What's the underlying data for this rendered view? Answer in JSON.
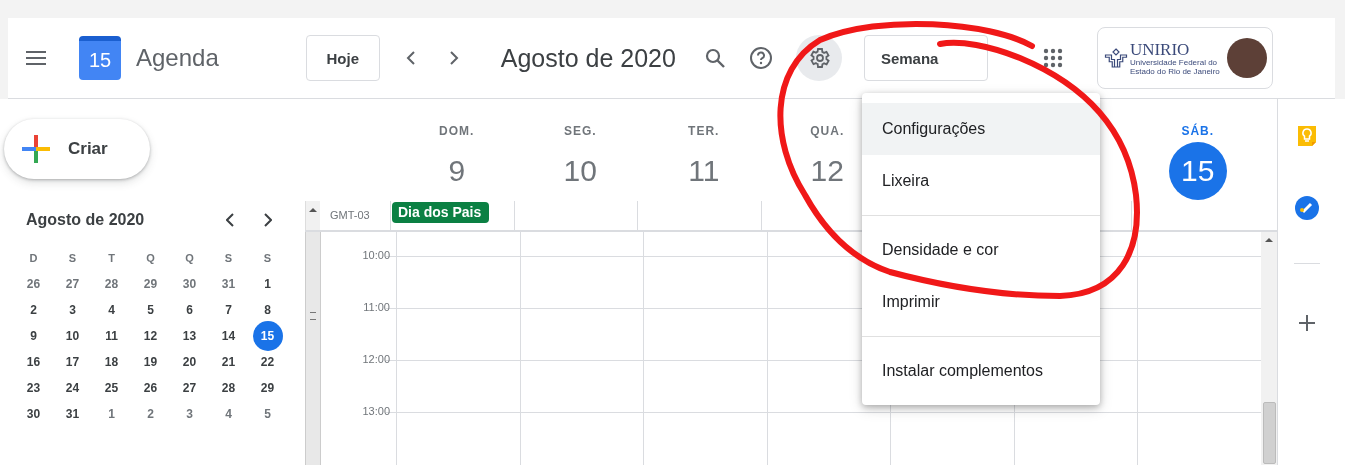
{
  "header": {
    "app_name": "Agenda",
    "logo_day": "15",
    "today_button": "Hoje",
    "period_title": "Agosto de 2020",
    "view_button": "Semana",
    "settings_pressed": true,
    "account": {
      "org_name": "UNIRIO",
      "org_subtitle_lines": [
        "Universidade Federal do",
        "Estado do Rio de Janeiro"
      ]
    }
  },
  "create_button": "Criar",
  "mini_calendar": {
    "title": "Agosto de 2020",
    "weekdays": [
      "D",
      "S",
      "T",
      "Q",
      "Q",
      "S",
      "S"
    ],
    "weeks": [
      [
        {
          "text": "26",
          "other_month": true,
          "selected": false
        },
        {
          "text": "27",
          "other_month": true,
          "selected": false
        },
        {
          "text": "28",
          "other_month": true,
          "selected": false
        },
        {
          "text": "29",
          "other_month": true,
          "selected": false
        },
        {
          "text": "30",
          "other_month": true,
          "selected": false
        },
        {
          "text": "31",
          "other_month": true,
          "selected": false
        },
        {
          "text": "1",
          "other_month": false,
          "selected": false
        }
      ],
      [
        {
          "text": "2",
          "other_month": false,
          "selected": false
        },
        {
          "text": "3",
          "other_month": false,
          "selected": false
        },
        {
          "text": "4",
          "other_month": false,
          "selected": false
        },
        {
          "text": "5",
          "other_month": false,
          "selected": false
        },
        {
          "text": "6",
          "other_month": false,
          "selected": false
        },
        {
          "text": "7",
          "other_month": false,
          "selected": false
        },
        {
          "text": "8",
          "other_month": false,
          "selected": false
        }
      ],
      [
        {
          "text": "9",
          "other_month": false,
          "selected": false
        },
        {
          "text": "10",
          "other_month": false,
          "selected": false
        },
        {
          "text": "11",
          "other_month": false,
          "selected": false
        },
        {
          "text": "12",
          "other_month": false,
          "selected": false
        },
        {
          "text": "13",
          "other_month": false,
          "selected": false
        },
        {
          "text": "14",
          "other_month": false,
          "selected": false
        },
        {
          "text": "15",
          "other_month": false,
          "selected": true
        }
      ],
      [
        {
          "text": "16",
          "other_month": false,
          "selected": false
        },
        {
          "text": "17",
          "other_month": false,
          "selected": false
        },
        {
          "text": "18",
          "other_month": false,
          "selected": false
        },
        {
          "text": "19",
          "other_month": false,
          "selected": false
        },
        {
          "text": "20",
          "other_month": false,
          "selected": false
        },
        {
          "text": "21",
          "other_month": false,
          "selected": false
        },
        {
          "text": "22",
          "other_month": false,
          "selected": false
        }
      ],
      [
        {
          "text": "23",
          "other_month": false,
          "selected": false
        },
        {
          "text": "24",
          "other_month": false,
          "selected": false
        },
        {
          "text": "25",
          "other_month": false,
          "selected": false
        },
        {
          "text": "26",
          "other_month": false,
          "selected": false
        },
        {
          "text": "27",
          "other_month": false,
          "selected": false
        },
        {
          "text": "28",
          "other_month": false,
          "selected": false
        },
        {
          "text": "29",
          "other_month": false,
          "selected": false
        }
      ],
      [
        {
          "text": "30",
          "other_month": false,
          "selected": false
        },
        {
          "text": "31",
          "other_month": false,
          "selected": false
        },
        {
          "text": "1",
          "other_month": true,
          "selected": false
        },
        {
          "text": "2",
          "other_month": true,
          "selected": false
        },
        {
          "text": "3",
          "other_month": true,
          "selected": false
        },
        {
          "text": "4",
          "other_month": true,
          "selected": false
        },
        {
          "text": "5",
          "other_month": true,
          "selected": false
        }
      ]
    ]
  },
  "week": {
    "days": [
      {
        "label": "DOM.",
        "number": "9",
        "selected": false
      },
      {
        "label": "SEG.",
        "number": "10",
        "selected": false
      },
      {
        "label": "TER.",
        "number": "11",
        "selected": false
      },
      {
        "label": "QUA.",
        "number": "12",
        "selected": false
      },
      {
        "label": "SÁB.",
        "number": "15",
        "selected": true
      }
    ],
    "timezone": "GMT-03",
    "all_day_events": [
      {
        "title": "Dia dos Pais",
        "color": "#0b8043"
      }
    ],
    "hours": [
      "10:00",
      "11:00",
      "12:00",
      "13:00"
    ]
  },
  "settings_menu": {
    "groups": [
      [
        {
          "label": "Configurações",
          "selected": true
        },
        {
          "label": "Lixeira",
          "selected": false
        }
      ],
      [
        {
          "label": "Densidade e cor",
          "selected": false
        },
        {
          "label": "Imprimir",
          "selected": false
        }
      ],
      [
        {
          "label": "Instalar complementos",
          "selected": false
        }
      ]
    ]
  }
}
